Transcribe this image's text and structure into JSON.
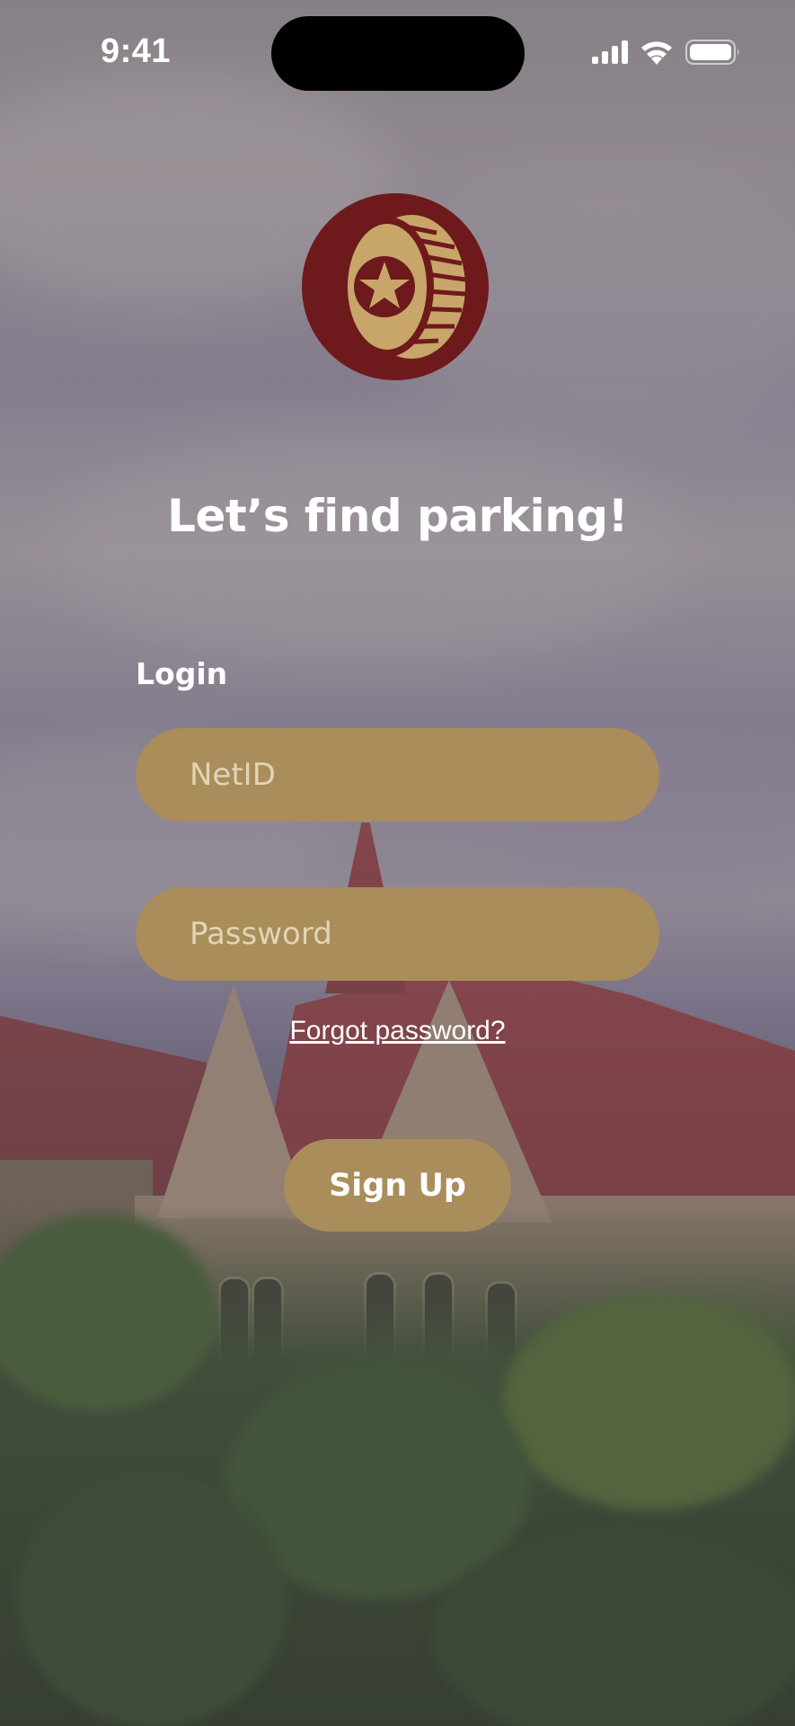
{
  "status_bar": {
    "time": "9:41",
    "icons": [
      "signal-icon",
      "wifi-icon",
      "battery-icon"
    ]
  },
  "logo": {
    "icon": "tire-star-logo",
    "colors": {
      "outer": "#6e1a1d",
      "inner": "#c8a66a"
    }
  },
  "headline": "Let’s find parking!",
  "login": {
    "label": "Login",
    "netid_placeholder": "NetID",
    "password_placeholder": "Password",
    "forgot_password": "Forgot password?",
    "signup_label": "Sign Up"
  },
  "colors": {
    "accent": "#a98d5a",
    "brand_maroon": "#6e1a1d",
    "text": "#ffffff"
  }
}
